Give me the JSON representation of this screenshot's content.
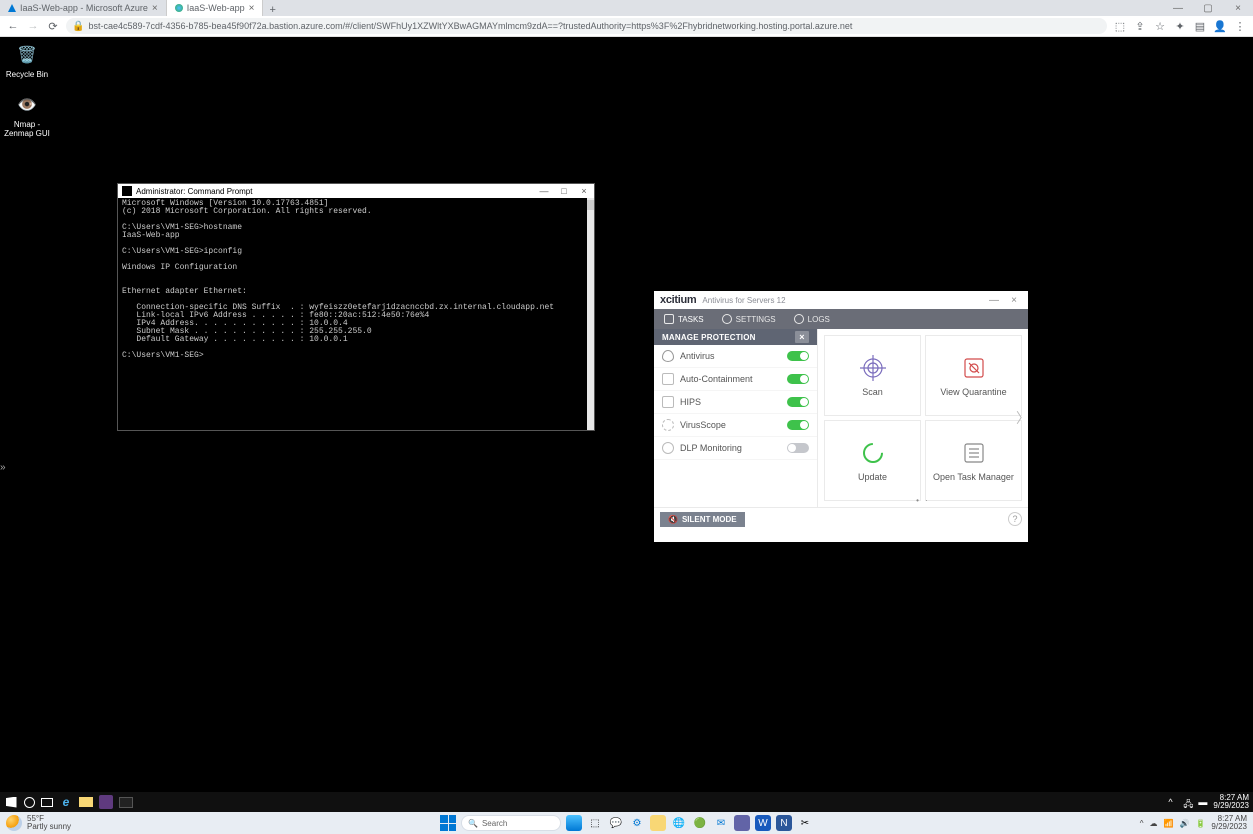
{
  "chrome": {
    "tabs": [
      {
        "title": "IaaS-Web-app - Microsoft Azure"
      },
      {
        "title": "IaaS-Web-app"
      }
    ],
    "url": "bst-cae4c589-7cdf-4356-b785-bea45f90f72a.bastion.azure.com/#/client/SWFhUy1XZWltYXBwAGMAYmlmcm9zdA==?trustedAuthority=https%3F%2Fhybridnetworking.hosting.portal.azure.net"
  },
  "desktop_icons": [
    {
      "label": "Recycle Bin"
    },
    {
      "label": "Nmap - Zenmap GUI"
    }
  ],
  "cmd": {
    "title": "Administrator: Command Prompt",
    "output": "Microsoft Windows [Version 10.0.17763.4851]\n(c) 2018 Microsoft Corporation. All rights reserved.\n\nC:\\Users\\VM1-SEG>hostname\nIaaS-Web-app\n\nC:\\Users\\VM1-SEG>ipconfig\n\nWindows IP Configuration\n\n\nEthernet adapter Ethernet:\n\n   Connection-specific DNS Suffix  . : wyfeiszz0etefarj1dzacnccbd.zx.internal.cloudapp.net\n   Link-local IPv6 Address . . . . . : fe80::20ac:512:4e50:76e%4\n   IPv4 Address. . . . . . . . . . . : 10.0.0.4\n   Subnet Mask . . . . . . . . . . . : 255.255.255.0\n   Default Gateway . . . . . . . . . : 10.0.0.1\n\nC:\\Users\\VM1-SEG>"
  },
  "xcitium": {
    "brand": "xcitium",
    "subtitle": "Antivirus for Servers  12",
    "nav": {
      "tasks": "TASKS",
      "settings": "SETTINGS",
      "logs": "LOGS"
    },
    "panel_title": "MANAGE PROTECTION",
    "items": [
      {
        "label": "Antivirus",
        "on": true
      },
      {
        "label": "Auto-Containment",
        "on": true
      },
      {
        "label": "HIPS",
        "on": true
      },
      {
        "label": "VirusScope",
        "on": true
      },
      {
        "label": "DLP Monitoring",
        "on": false
      }
    ],
    "cards": {
      "scan": "Scan",
      "quarantine": "View Quarantine",
      "update": "Update",
      "taskmgr": "Open Task Manager"
    },
    "silent": "SILENT MODE"
  },
  "remote_tray": {
    "time": "8:27 AM",
    "date": "9/29/2023"
  },
  "host_weather": {
    "temp": "55°F",
    "desc": "Partly sunny"
  },
  "host_search": {
    "placeholder": "Search"
  },
  "host_tray": {
    "time": "8:27 AM",
    "date": "9/29/2023"
  }
}
